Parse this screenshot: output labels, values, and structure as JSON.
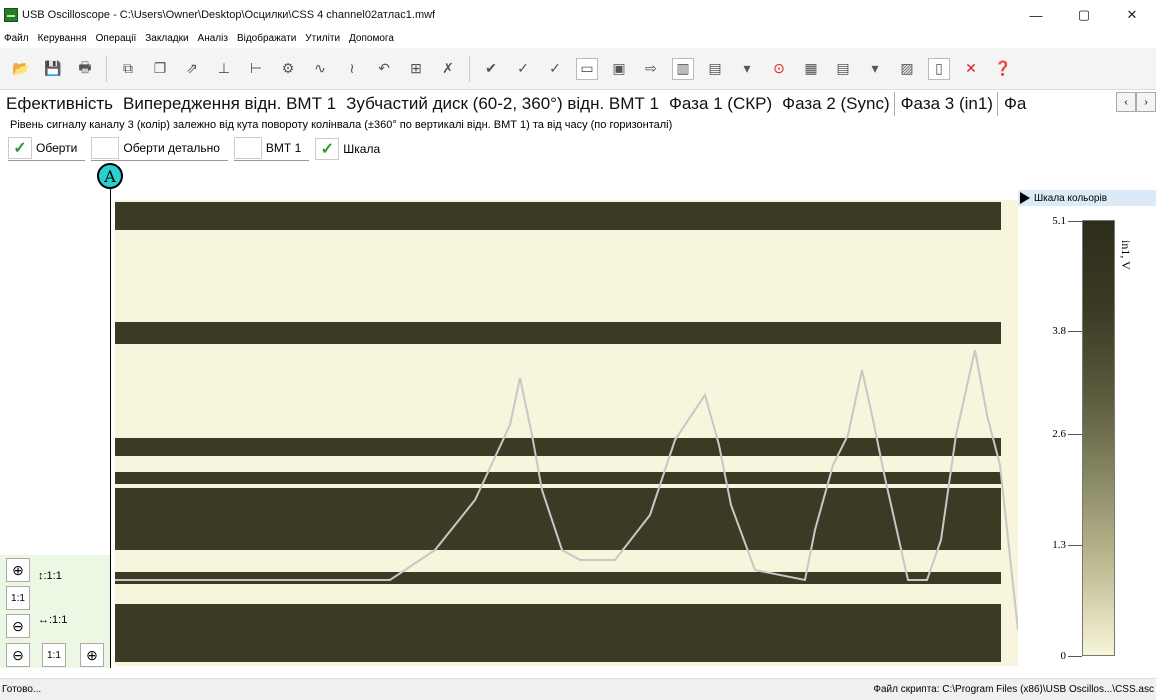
{
  "window": {
    "title": "USB Oscilloscope - C:\\Users\\Owner\\Desktop\\Осцилки\\CSS 4 channel02атлас1.mwf",
    "controls": [
      "—",
      "▢",
      "✕"
    ]
  },
  "menu": [
    "Файл",
    "Керування",
    "Операції",
    "Закладки",
    "Аналіз",
    "Відображати",
    "Утиліти",
    "Допомога"
  ],
  "tabs": [
    "Ефективність",
    "Випередження відн. ВМТ 1",
    "Зубчастий диск (60-2, 360°) відн. ВМТ 1",
    "Фаза 1 (СКР)",
    "Фаза 2 (Sync)",
    "Фаза 3 (in1)",
    "Фа"
  ],
  "active_tab": "Фаза 3 (in1)",
  "tab_scroll": [
    "‹",
    "›"
  ],
  "description": "Рівень сигналу каналу 3 (колір) залежно від кута повороту колінвала (±360° по вертикалі відн. ВМТ 1) та від часу (по горизонталі)",
  "options": {
    "rotations": {
      "label": "Оберти",
      "checked": true
    },
    "rotations_detail": {
      "label": "Оберти детально",
      "checked": false
    },
    "tdc": {
      "label": "ВМТ 1",
      "checked": false
    },
    "scale": {
      "label": "Шкала",
      "checked": true
    }
  },
  "marker_label": "A",
  "zoom": {
    "plus": "⊕",
    "minus": "⊖",
    "one_to_one": "1:1",
    "vertical_ratio": "↕:1:1",
    "horizontal_ratio": "↔:1:1"
  },
  "scale_panel": {
    "header": "Шкала кольорів",
    "unit": "in1, V",
    "ticks": [
      "5.1",
      "3.8",
      "2.6",
      "1.3",
      "0"
    ]
  },
  "status": {
    "left": "Готово...",
    "right": "Файл скрипта: C:\\Program Files (x86)\\USB Oscillos...\\CSS.asc"
  },
  "colors": {
    "dark_band": "#3b3a24",
    "light_band": "#f7f5dc",
    "trace": "#c7c7c7",
    "marker": "#2ad0d0"
  }
}
